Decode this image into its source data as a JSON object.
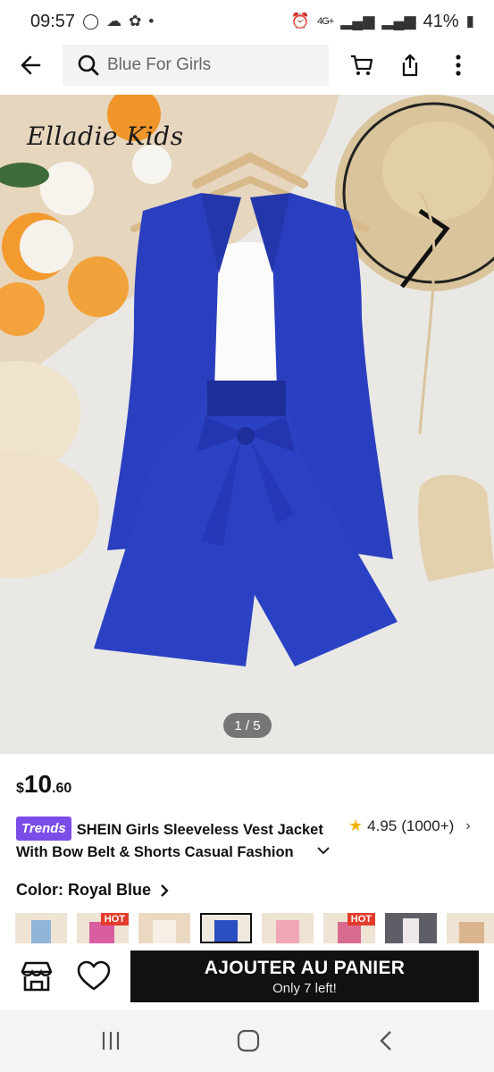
{
  "status": {
    "time": "09:57",
    "network": "4G+",
    "battery": "41%"
  },
  "topbar": {
    "search_placeholder": "Blue For Girls"
  },
  "hero": {
    "brand_watermark": "Elladie Kids",
    "pager": "1 / 5"
  },
  "product": {
    "price_currency": "$",
    "price_int": "10",
    "price_dec": ".60",
    "badge": "Trends",
    "title": "SHEIN Girls Sleeveless Vest Jacket With Bow Belt & Shorts Casual Fashion",
    "rating": "4.95",
    "review_count": "(1000+)",
    "color_label": "Color: Royal Blue"
  },
  "swatches": [
    {
      "hot": false,
      "color": "#8fb6d8"
    },
    {
      "hot": true,
      "hot_label": "HOT",
      "color": "#d85ea0"
    },
    {
      "hot": false,
      "color": "#efe3d3"
    },
    {
      "hot": false,
      "color": "#2a4fc4",
      "selected": true
    },
    {
      "hot": false,
      "color": "#f0a8b8"
    },
    {
      "hot": true,
      "hot_label": "HOT",
      "color": "#d86b8d"
    },
    {
      "hot": false,
      "color": "#eee8ea"
    },
    {
      "hot": false,
      "color": "#d9b48e"
    }
  ],
  "actions": {
    "cart_label": "AJOUTER AU PANIER",
    "stock_note": "Only 7 left!"
  },
  "colors": {
    "accent_dark": "#111111",
    "trends_purple": "#7b4de8",
    "hot_red": "#e23c2c",
    "star": "#f5b301",
    "garment_blue": "#2a3fbf"
  }
}
